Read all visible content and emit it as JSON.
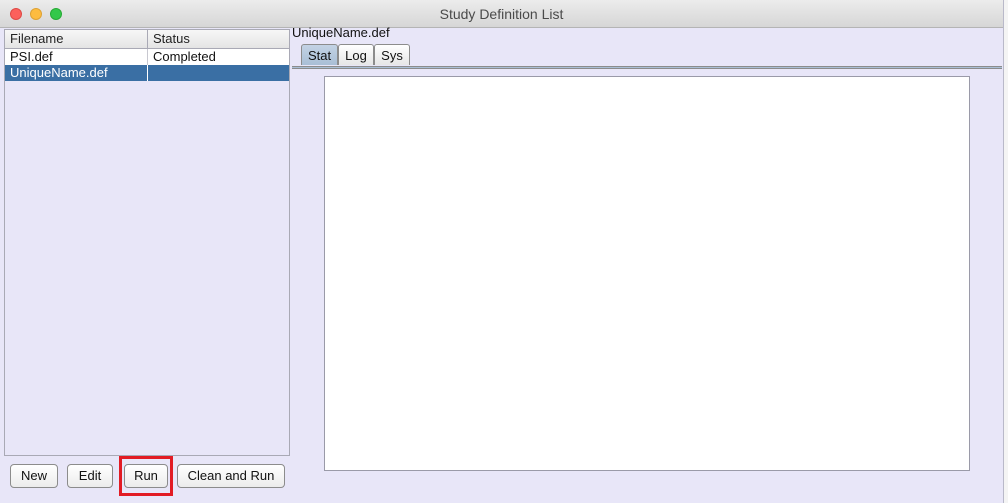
{
  "window": {
    "title": "Study Definition List"
  },
  "table": {
    "headers": [
      "Filename",
      "Status"
    ],
    "rows": [
      {
        "filename": "PSI.def",
        "status": "Completed"
      },
      {
        "filename": "UniqueName.def",
        "status": ""
      }
    ]
  },
  "buttons": {
    "new": "New",
    "edit": "Edit",
    "run": "Run",
    "clean_and_run": "Clean and Run"
  },
  "detail": {
    "filename": "UniqueName.def",
    "tabs": [
      "Stat",
      "Log",
      "Sys"
    ],
    "selected_tab": "Stat"
  },
  "colors": {
    "selection": "#3a6fa4",
    "highlight_box": "#e21b24",
    "window_bg": "#e8e6f8"
  }
}
